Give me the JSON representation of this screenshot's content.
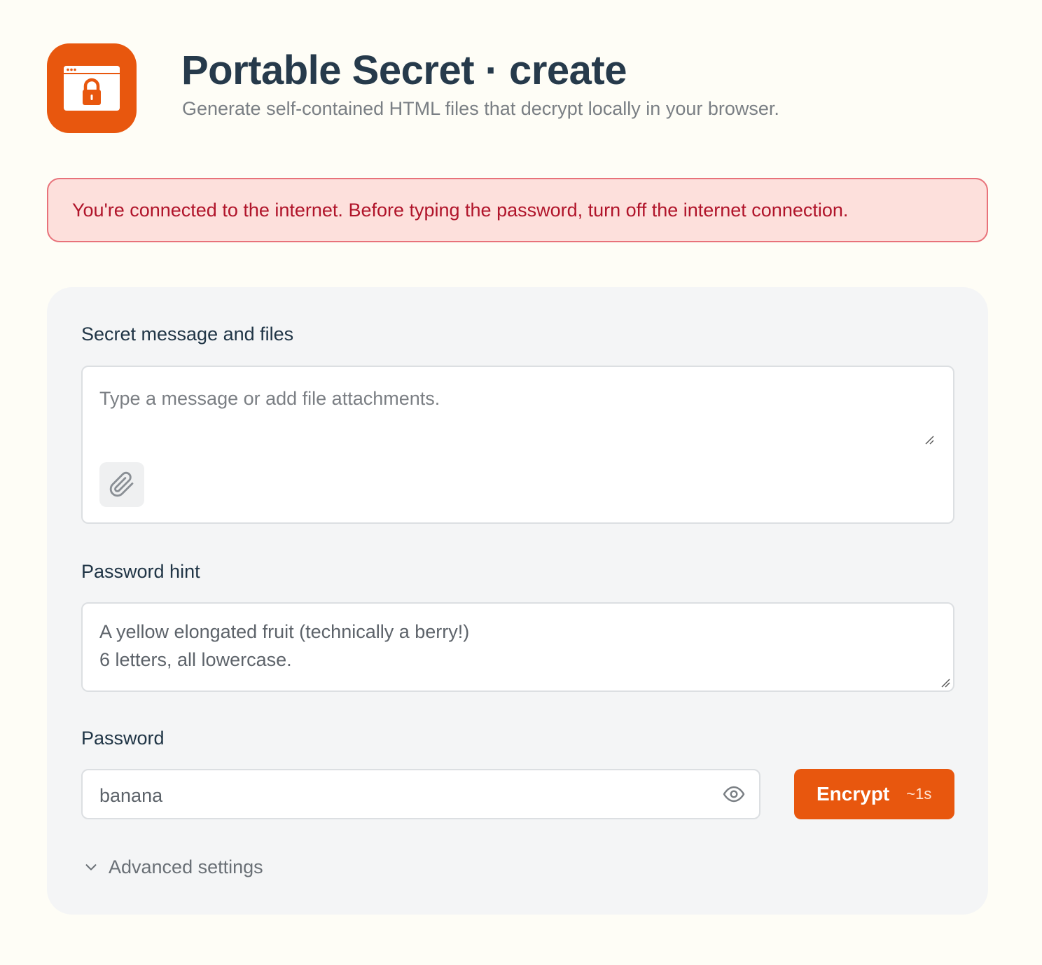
{
  "header": {
    "title": "Portable Secret · create",
    "subtitle": "Generate self-contained HTML files that decrypt locally in your browser.",
    "logo_icon": "browser-lock-icon",
    "logo_color": "#e8570e"
  },
  "alert": {
    "message": "You're connected to the internet. Before typing the password, turn off the internet connection.",
    "text_color": "#b0142a",
    "background": "#fde0dc"
  },
  "form": {
    "message": {
      "label": "Secret message and files",
      "placeholder": "Type a message or add file attachments.",
      "value": "",
      "attach_icon": "paperclip-icon"
    },
    "hint": {
      "label": "Password hint",
      "value": "A yellow elongated fruit (technically a berry!)\n6 letters, all lowercase."
    },
    "password": {
      "label": "Password",
      "value": "banana",
      "toggle_icon": "eye-icon"
    },
    "encrypt": {
      "label": "Encrypt",
      "time_estimate": "~1s",
      "color": "#e8570e"
    },
    "advanced": {
      "label": "Advanced settings",
      "icon": "chevron-down-icon"
    }
  }
}
